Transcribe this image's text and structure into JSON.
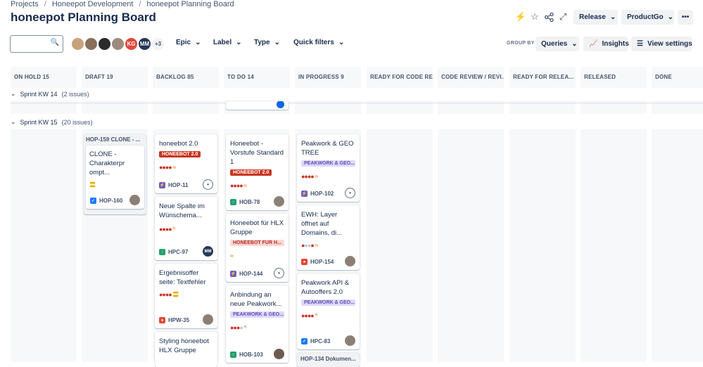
{
  "breadcrumbs": [
    "Projects",
    "Honeepot Development",
    "honeepot Planning Board"
  ],
  "title": "honeepot Planning Board",
  "top_actions": {
    "release": "Release",
    "product": "ProductGo"
  },
  "search": {
    "placeholder": ""
  },
  "avatars_more": "+3",
  "avatar_initials": [
    "KG",
    "MM"
  ],
  "filters": [
    "Epic",
    "Label",
    "Type",
    "Quick filters"
  ],
  "group_by_label": "GROUP BY",
  "group_by_value": "Queries",
  "insights": "Insights",
  "view_settings": "View settings",
  "columns": [
    "ON HOLD 15",
    "DRAFT 19",
    "BACKLOG 85",
    "TO DO 14",
    "IN PROGRESS 9",
    "READY FOR CODE RE...",
    "CODE REVIEW / REVI...",
    "READY FOR RELEA... 2",
    "RELEASED",
    "DONE"
  ],
  "sprints": [
    {
      "name": "Sprint KW 14",
      "count": "(2 issues)"
    },
    {
      "name": "Sprint KW 15",
      "count": "(20 issues)"
    }
  ],
  "cards": {
    "draft_parent": "HOP-159 CLONE - ...",
    "draft_child": {
      "title": "CLONE - Charakterpr ompt...",
      "key": "HOP-160"
    },
    "backlog": [
      {
        "title": "honeebot 2.0",
        "label": "HONEEBOT 2.0",
        "key": "HOP-11"
      },
      {
        "title": "Neue Spalte im Wünschema...",
        "key": "HPC-97",
        "av": "MM"
      },
      {
        "title": "Ergebnisoffer seite: Textfehler",
        "key": "HPW-35"
      },
      {
        "title": "Styling honeebot HLX Gruppe"
      }
    ],
    "todo": [
      {
        "title": "Honeebot - Vorstufe Standard 1",
        "label": "HONEEBOT 2.0",
        "key": "HOB-78"
      },
      {
        "title": "Honeebot für HLX Gruppe",
        "label": "HONEEBOT FÜR H...",
        "key": "HOP-144"
      },
      {
        "title": "Anbindung an neue Peakwork...",
        "label": "PEAKWORK & GEO...",
        "key": "HOB-103"
      }
    ],
    "inprogress": [
      {
        "title": "Peakwork & GEO TREE",
        "label": "PEAKWORK & GEO...",
        "key": "HOP-102"
      },
      {
        "title": "EWH: Layer öffnet auf Domains, di...",
        "key": "HOP-154"
      },
      {
        "title": "Peakwork API & Autooffers 2.0",
        "label": "PEAKWORK & GEO...",
        "key": "HPC-83"
      },
      {
        "title": "HOP-134 Dokumen..."
      }
    ]
  },
  "colors": {
    "accent": "#0c66e4",
    "red_label": "#ca3521",
    "purple_label": "#dfd8fd"
  }
}
